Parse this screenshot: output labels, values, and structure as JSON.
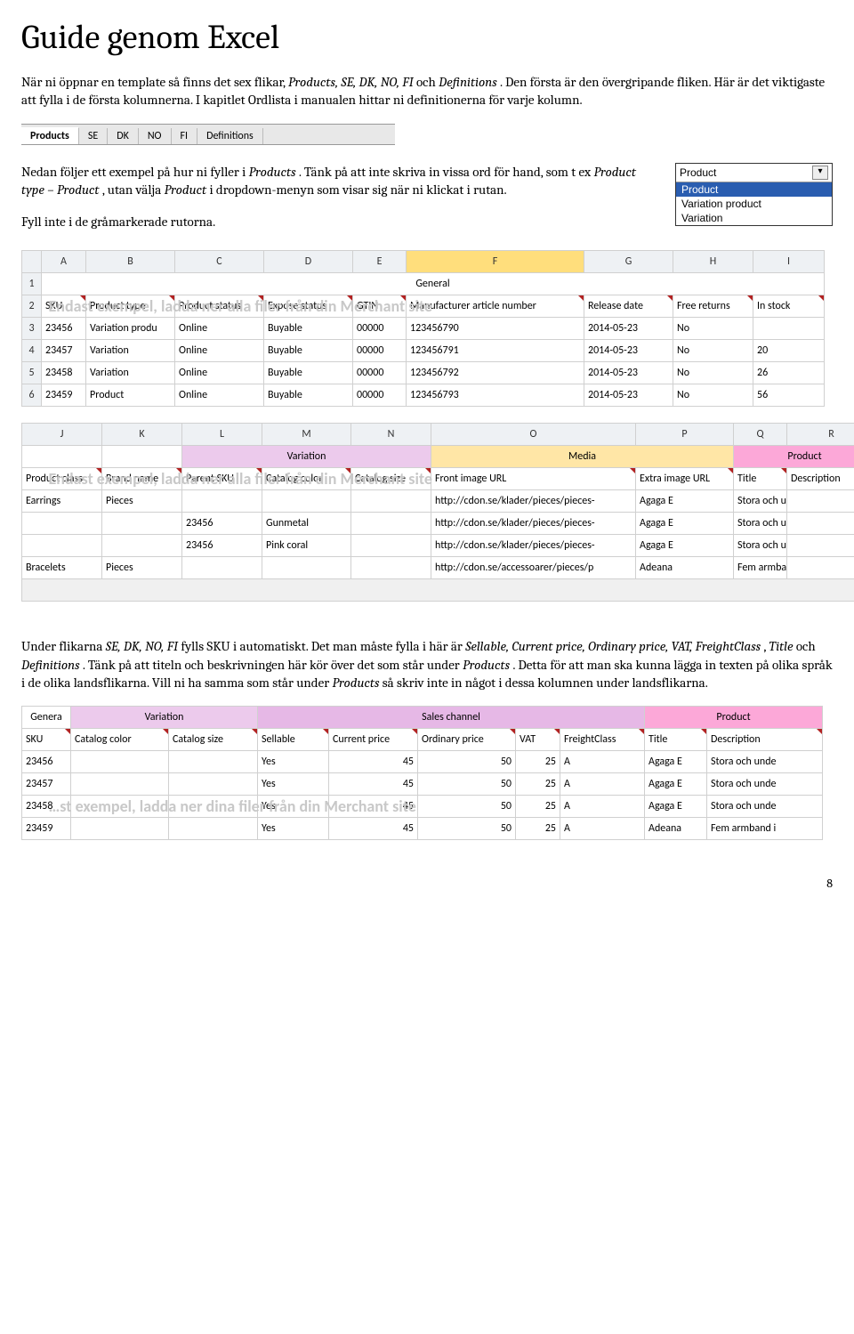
{
  "heading": "Guide genom Excel",
  "intro": {
    "p1a": "När ni öppnar en template så finns det sex flikar, ",
    "p1b": "Products, SE, DK, NO, FI ",
    "p1c": "och ",
    "p1d": "Definitions",
    "p1e": ". Den första är den övergripande fliken. Här är det viktigaste att fylla i de första kolumnerna. I kapitlet Ordlista i manualen hittar ni definitionerna för varje kolumn."
  },
  "tabs": [
    "Products",
    "SE",
    "DK",
    "NO",
    "FI",
    "Definitions"
  ],
  "para2": {
    "a": "Nedan följer ett exempel på hur ni fyller i ",
    "b": "Products",
    "c": ". Tänk på att inte skriva in vissa ord för hand, som t ex ",
    "d": "Product type – Product",
    "e": ", utan välja ",
    "f": "Product",
    "g": " i dropdown-menyn som visar sig när ni klickat i rutan."
  },
  "para3": "Fyll inte i de gråmarkerade rutorna.",
  "dropdown": {
    "label": "Product",
    "options": [
      "Product",
      "Variation product",
      "Variation"
    ]
  },
  "sheet1": {
    "cols": [
      "A",
      "B",
      "C",
      "D",
      "E",
      "F",
      "G",
      "H",
      "I"
    ],
    "group1": "General",
    "headers": [
      "SKU",
      "Product type",
      "Product status",
      "Expose status",
      "GTIN",
      "Manufacturer article number",
      "Release date",
      "Free returns",
      "In stock"
    ],
    "rows": [
      {
        "n": "3",
        "c": [
          "23456",
          "Variation produ",
          "Online",
          "Buyable",
          "00000",
          "123456790",
          "2014-05-23",
          "No",
          ""
        ]
      },
      {
        "n": "4",
        "c": [
          "23457",
          "Variation",
          "Online",
          "Buyable",
          "00000",
          "123456791",
          "2014-05-23",
          "No",
          "20"
        ]
      },
      {
        "n": "5",
        "c": [
          "23458",
          "Variation",
          "Online",
          "Buyable",
          "00000",
          "123456792",
          "2014-05-23",
          "No",
          "26"
        ]
      },
      {
        "n": "6",
        "c": [
          "23459",
          "Product",
          "Online",
          "Buyable",
          "00000",
          "123456793",
          "2014-05-23",
          "No",
          "56"
        ]
      }
    ],
    "watermark": "Endast exempel, ladda ner alla filer från din Merchant site"
  },
  "sheet2": {
    "cols": [
      "J",
      "K",
      "L",
      "M",
      "N",
      "O",
      "P",
      "Q",
      "R"
    ],
    "groups": [
      "",
      "",
      "Variation",
      "",
      "",
      "Media",
      "",
      "Product",
      ""
    ],
    "headers": [
      "Product class",
      "Brand name",
      "Parent SKU",
      "Catalog color",
      "Catalog size",
      "Front image URL",
      "Extra image URL",
      "Title",
      "Description"
    ],
    "rows": [
      [
        "Earrings",
        "Pieces",
        "",
        "",
        "",
        "http://cdon.se/klader/pieces/pieces-",
        "Agaga E",
        "Stora och unde",
        ""
      ],
      [
        "",
        "",
        "23456",
        "Gunmetal",
        "",
        "http://cdon.se/klader/pieces/pieces-",
        "Agaga E",
        "Stora och unde",
        ""
      ],
      [
        "",
        "",
        "23456",
        "Pink coral",
        "",
        "http://cdon.se/klader/pieces/pieces-",
        "Agaga E",
        "Stora och unde",
        ""
      ],
      [
        "Bracelets",
        "Pieces",
        "",
        "",
        "",
        "http://cdon.se/accessoarer/pieces/p",
        "Adeana",
        "Fem armband",
        ""
      ]
    ],
    "watermark": "Endast exempel, ladda ner alla filer från din Merchant site"
  },
  "para4": {
    "a": "Under flikarna ",
    "b": "SE, DK, NO, FI",
    "c": " fylls SKU i automatiskt. Det man måste fylla i här är ",
    "d": "Sellable, Current price, Ordinary price, VAT, FreightClass",
    "e": ", ",
    "f": "Title",
    "g": " och ",
    "h": "Definitions",
    "i": ". Tänk på att titeln och beskrivningen här kör över det som står under ",
    "j": "Products",
    "k": ". Detta för att man ska kunna lägga in texten på olika språk i de olika landsflikarna. Vill ni ha samma som står under ",
    "l": "Products",
    "m": " så skriv inte in något i dessa kolumnen under landsflikarna."
  },
  "sheet3": {
    "groups": [
      "Genera",
      "Variation",
      "",
      "",
      "Sales channel",
      "",
      "",
      "",
      "Product",
      ""
    ],
    "headers": [
      "SKU",
      "Catalog color",
      "Catalog size",
      "Sellable",
      "Current price",
      "Ordinary price",
      "VAT",
      "FreightClass",
      "Title",
      "Description"
    ],
    "rows": [
      [
        "23456",
        "",
        "",
        "Yes",
        "45",
        "50",
        "25",
        "A",
        "Agaga E",
        "Stora och unde"
      ],
      [
        "23457",
        "",
        "",
        "Yes",
        "45",
        "50",
        "25",
        "A",
        "Agaga E",
        "Stora och unde"
      ],
      [
        "23458",
        "",
        "",
        "Yes",
        "45",
        "50",
        "25",
        "A",
        "Agaga E",
        "Stora och unde"
      ],
      [
        "23459",
        "",
        "",
        "Yes",
        "45",
        "50",
        "25",
        "A",
        "Adeana",
        "Fem armband i"
      ]
    ],
    "watermark": "…st exempel, ladda ner dina filer från din Merchant site"
  },
  "pagenum": "8"
}
